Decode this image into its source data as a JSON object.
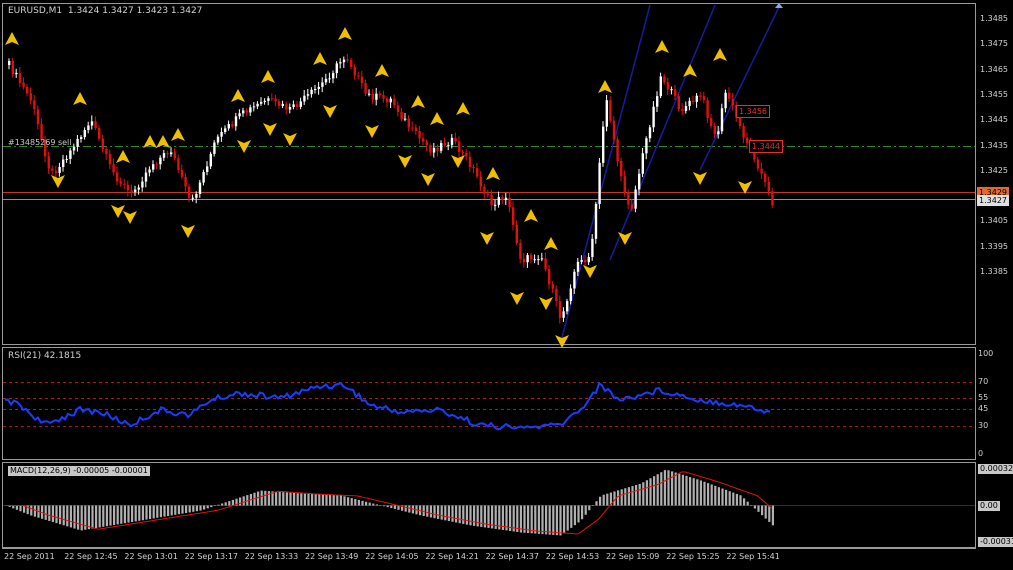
{
  "header": {
    "symbol": "EURUSD,M1",
    "ohlc": "1.3424 1.3427 1.3423 1.3427"
  },
  "main_chart": {
    "price_labels": [
      "1.3485",
      "1.3475",
      "1.3465",
      "1.3455",
      "1.3445",
      "1.3435",
      "1.3425",
      "1.3415",
      "1.3405",
      "1.3395",
      "1.3385"
    ],
    "order_label": "#13485269 sell",
    "price_tags": {
      "level_1": "1.3456",
      "level_2": "1.3444",
      "order_price": "1.3429",
      "current": "1.3427"
    },
    "colors": {
      "bull": "#ffffff",
      "bear": "#e01010",
      "fractal": "#f0c000",
      "channel": "#1a1aa0",
      "order_line": "#2a8a2a",
      "order_price_line": "#c03a1a"
    }
  },
  "rsi_panel": {
    "title": "RSI(21) 42.1815",
    "levels": [
      "100",
      "70",
      "55",
      "45",
      "30",
      "0"
    ],
    "line_color": "#1a3cff"
  },
  "macd_panel": {
    "label": "MACD(12,26,9) -0.00005 -0.00001",
    "right_top": "0.000321",
    "right_mid": "0.00",
    "right_bottom": "-0.000314"
  },
  "time_axis": [
    "22 Sep 2011",
    "22 Sep 12:45",
    "22 Sep 13:01",
    "22 Sep 13:17",
    "22 Sep 13:33",
    "22 Sep 13:49",
    "22 Sep 14:05",
    "22 Sep 14:21",
    "22 Sep 14:37",
    "22 Sep 14:53",
    "22 Sep 15:09",
    "22 Sep 15:25",
    "22 Sep 15:41"
  ]
}
